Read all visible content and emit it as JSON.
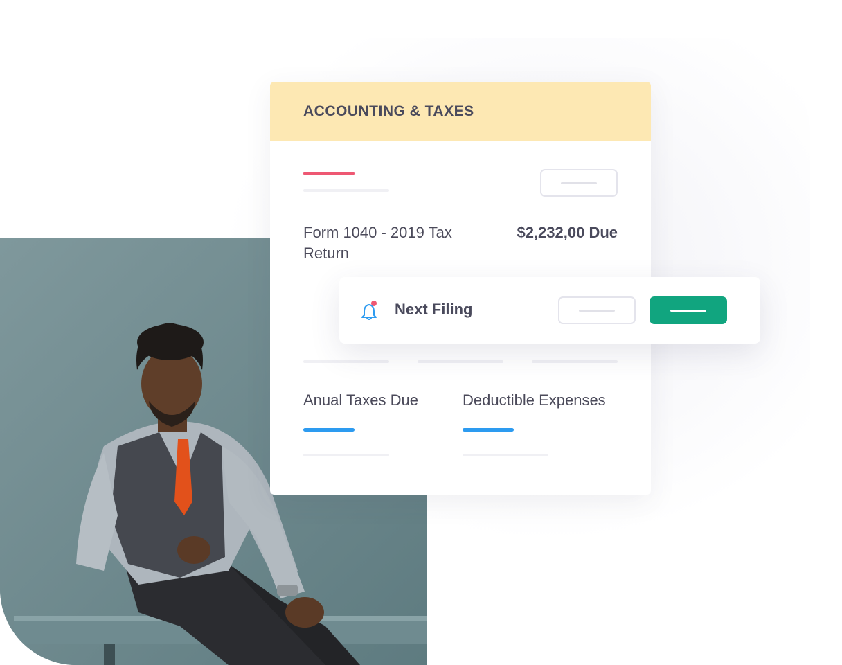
{
  "card": {
    "title": "ACCOUNTING & TAXES",
    "form_label": "Form 1040 - 2019 Tax Return",
    "amount_due": "$2,232,00 Due",
    "stats": [
      {
        "label": "Anual Taxes Due"
      },
      {
        "label": "Deductible Expenses"
      }
    ]
  },
  "notice": {
    "label": "Next Filing",
    "icon": "bell-icon"
  },
  "colors": {
    "header_bg": "#fde8b3",
    "accent_red": "#ee5873",
    "accent_blue": "#2d9bf0",
    "primary_green": "#11a57f"
  }
}
